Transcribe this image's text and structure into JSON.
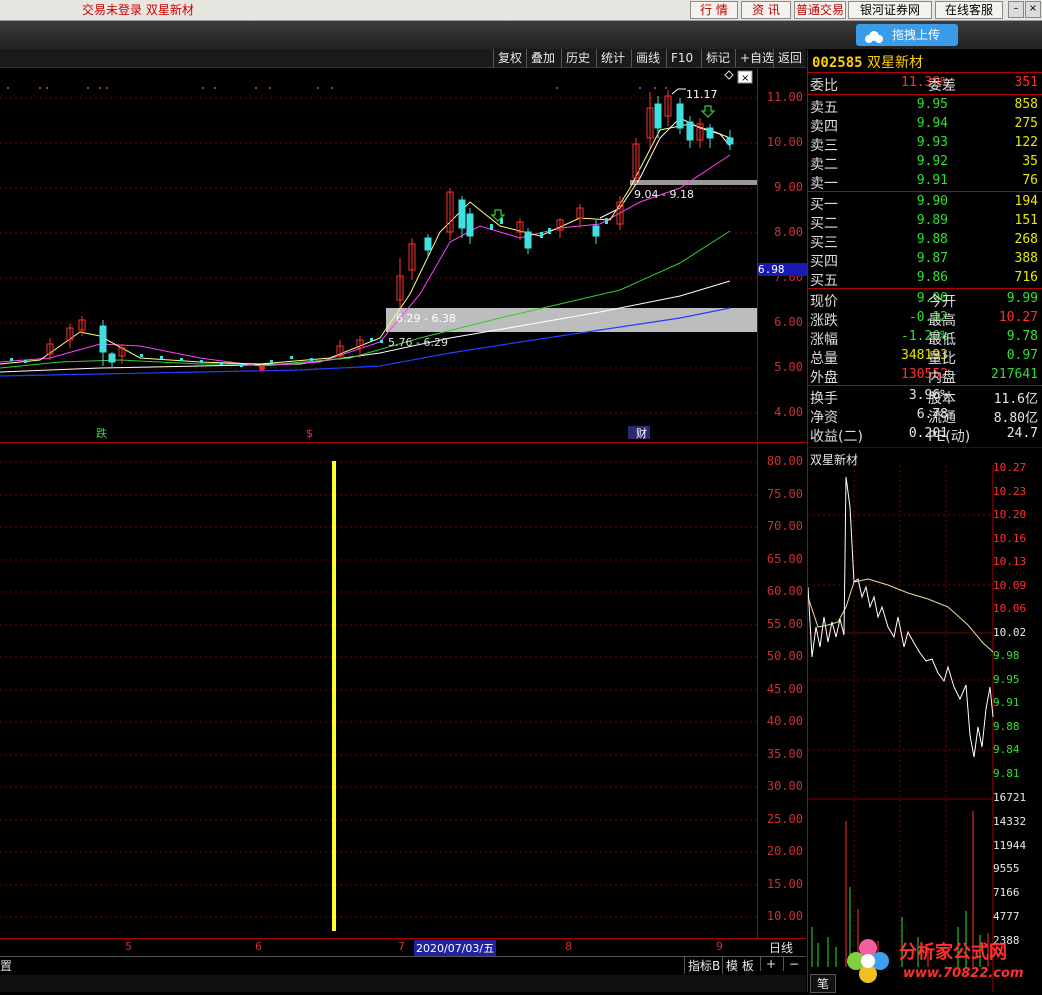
{
  "topbar": {
    "title": "交易未登录  双星新材",
    "buttons": [
      "行 情",
      "资 讯",
      "普通交易",
      "银河证券网",
      "在线客服"
    ]
  },
  "upload_btn": "拖拽上传",
  "toolbar": [
    "复权",
    "叠加",
    "历史",
    "统计",
    "画线",
    "F10",
    "标记",
    "+自选",
    "返回"
  ],
  "main_chart": {
    "y_ticks": [
      "11.00",
      "10.00",
      "9.00",
      "8.00",
      "7.00",
      "6.00",
      "5.00",
      "4.00"
    ],
    "high_label": "11.17",
    "current_price_tag": "6.98",
    "box1_label": "9.04 - 9.18",
    "box2_label": "6.29 - 6.38",
    "box2_sub": "5.76 - 6.29",
    "markers": [
      "跌",
      "$",
      "财"
    ]
  },
  "indicator": {
    "y_ticks": [
      "80.00",
      "75.00",
      "70.00",
      "65.00",
      "60.00",
      "55.00",
      "50.00",
      "45.00",
      "40.00",
      "35.00",
      "30.00",
      "25.00",
      "20.00",
      "15.00",
      "10.00"
    ]
  },
  "x_axis": [
    "5",
    "6",
    "7",
    "2020/07/03/五",
    "8",
    "9"
  ],
  "period": "日线",
  "bottom": {
    "left": "置",
    "buttons": [
      "指标B",
      "模 板",
      "+",
      "−"
    ]
  },
  "quote": {
    "code": "002585",
    "name": "双星新材",
    "weibi_label": "委比",
    "weibi": "11.39%",
    "weicha_label": "委差",
    "weicha": "351",
    "sells": [
      {
        "label": "卖五",
        "price": "9.95",
        "vol": "858"
      },
      {
        "label": "卖四",
        "price": "9.94",
        "vol": "275"
      },
      {
        "label": "卖三",
        "price": "9.93",
        "vol": "122"
      },
      {
        "label": "卖二",
        "price": "9.92",
        "vol": "35"
      },
      {
        "label": "卖一",
        "price": "9.91",
        "vol": "76"
      }
    ],
    "buys": [
      {
        "label": "买一",
        "price": "9.90",
        "vol": "194"
      },
      {
        "label": "买二",
        "price": "9.89",
        "vol": "151"
      },
      {
        "label": "买三",
        "price": "9.88",
        "vol": "268"
      },
      {
        "label": "买四",
        "price": "9.87",
        "vol": "388"
      },
      {
        "label": "买五",
        "price": "9.86",
        "vol": "716"
      }
    ],
    "stats": [
      {
        "l1": "现价",
        "v1": "9.90",
        "l2": "今开",
        "v2": "9.99",
        "c1": "#30e030",
        "c2": "#30e030"
      },
      {
        "l1": "涨跌",
        "v1": "-0.12",
        "l2": "最高",
        "v2": "10.27",
        "c1": "#30e030",
        "c2": "#ff3030"
      },
      {
        "l1": "涨幅",
        "v1": "-1.20%",
        "l2": "最低",
        "v2": "9.78",
        "c1": "#30e030",
        "c2": "#30e030"
      },
      {
        "l1": "总量",
        "v1": "348193",
        "l2": "量比",
        "v2": "0.97",
        "c1": "#e8e800",
        "c2": "#30e030"
      },
      {
        "l1": "外盘",
        "v1": "130552",
        "l2": "内盘",
        "v2": "217641",
        "c1": "#ff3030",
        "c2": "#30e030"
      }
    ],
    "stats2": [
      {
        "l1": "换手",
        "v1": "3.96%",
        "l2": "股本",
        "v2": "11.6亿"
      },
      {
        "l1": "净资",
        "v1": "6.78",
        "l2": "流通",
        "v2": "8.80亿"
      },
      {
        "l1": "收益(二)",
        "v1": "0.201",
        "l2": "PE(动)",
        "v2": "24.7"
      }
    ]
  },
  "mini": {
    "title": "双星新材",
    "price_ticks": [
      "10.27",
      "10.23",
      "10.20",
      "10.16",
      "10.13",
      "10.09",
      "10.06",
      "10.02",
      "9.98",
      "9.95",
      "9.91",
      "9.88",
      "9.84",
      "9.81"
    ],
    "vol_ticks": [
      "16721",
      "14332",
      "11944",
      "9555",
      "7166",
      "4777",
      "2388"
    ],
    "bottom_tab": "笔"
  },
  "watermark": {
    "text": "分析家公式网",
    "url": "www.70822.com"
  }
}
